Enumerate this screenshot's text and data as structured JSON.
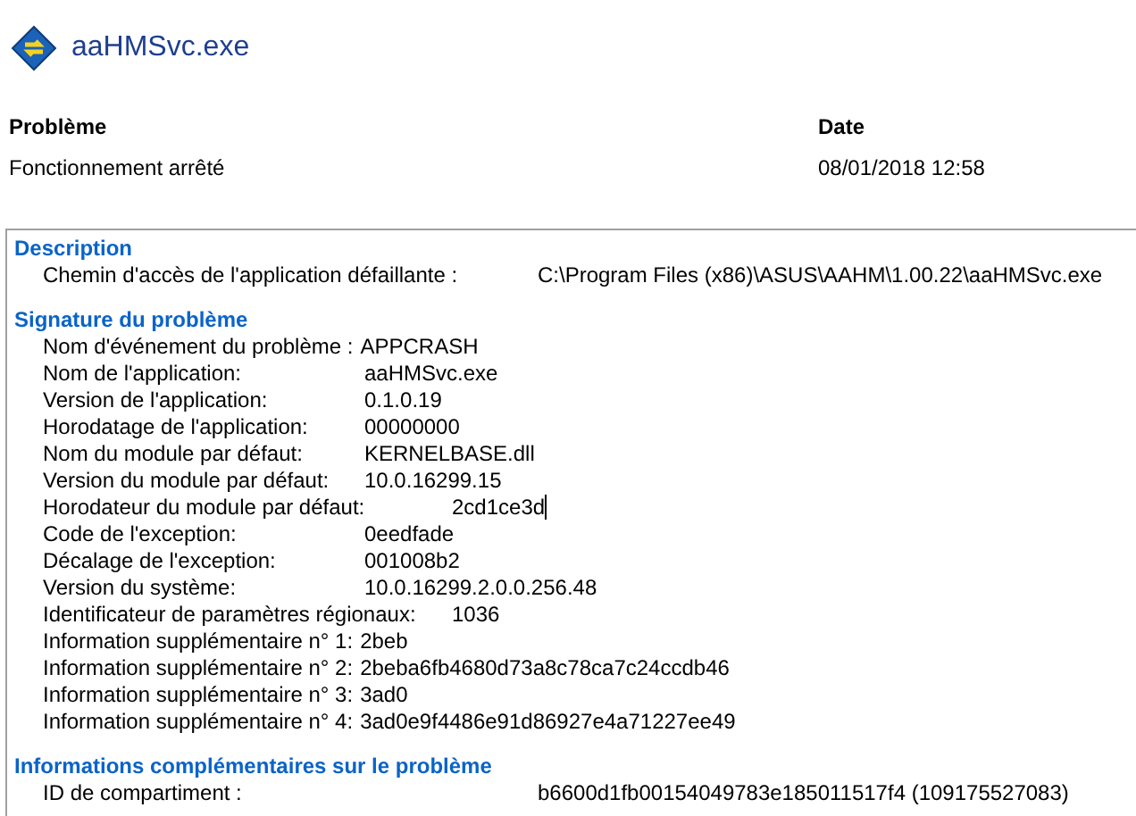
{
  "header": {
    "title": "aaHMSvc.exe"
  },
  "summary": {
    "columns": [
      {
        "heading": "Problème",
        "value": "Fonctionnement arrêté"
      },
      {
        "heading": "Date",
        "value": "08/01/2018 12:58"
      }
    ]
  },
  "sections": [
    {
      "heading": "Description",
      "fields": [
        {
          "label": "Chemin d'accès de l'application défaillante :",
          "value": "C:\\Program Files (x86)\\ASUS\\AAHM\\1.00.22\\aaHMSvc.exe",
          "kind": "path"
        }
      ]
    },
    {
      "heading": "Signature du problème",
      "fields": [
        {
          "label": "Nom d'événement du problème :",
          "value": "APPCRASH",
          "kind": "inline"
        },
        {
          "label": "Nom de l'application:",
          "value": "aaHMSvc.exe",
          "kind": "tabbed"
        },
        {
          "label": "Version de l'application:",
          "value": "0.1.0.19",
          "kind": "tabbed"
        },
        {
          "label": "Horodatage de l'application:",
          "value": "00000000",
          "kind": "tabbed"
        },
        {
          "label": "Nom du module par défaut:",
          "value": "KERNELBASE.dll",
          "kind": "tabbed"
        },
        {
          "label": "Version du module par défaut:",
          "value": "10.0.16299.15",
          "kind": "tabbed"
        },
        {
          "label": "Horodateur du module par défaut:",
          "value": "2cd1ce3d",
          "kind": "far",
          "cursor": true
        },
        {
          "label": "Code de l'exception:",
          "value": "0eedfade",
          "kind": "tabbed"
        },
        {
          "label": "Décalage de l'exception:",
          "value": "001008b2",
          "kind": "tabbed"
        },
        {
          "label": "Version du système:",
          "value": "10.0.16299.2.0.0.256.48",
          "kind": "tabbed"
        },
        {
          "label": "Identificateur de paramètres régionaux:",
          "value": "1036",
          "kind": "far"
        },
        {
          "label": "Information supplémentaire n° 1:",
          "value": "2beb",
          "kind": "inline"
        },
        {
          "label": "Information supplémentaire n° 2:",
          "value": "2beba6fb4680d73a8c78ca7c24ccdb46",
          "kind": "inline"
        },
        {
          "label": "Information supplémentaire n° 3:",
          "value": "3ad0",
          "kind": "inline"
        },
        {
          "label": "Information supplémentaire n° 4:",
          "value": "3ad0e9f4486e91d86927e4a71227ee49",
          "kind": "inline"
        }
      ]
    },
    {
      "heading": "Informations complémentaires sur le problème",
      "fields": [
        {
          "label": "ID de compartiment :",
          "value": "b6600d1fb00154049783e185011517f4 (109175527083)",
          "kind": "path"
        }
      ]
    }
  ]
}
